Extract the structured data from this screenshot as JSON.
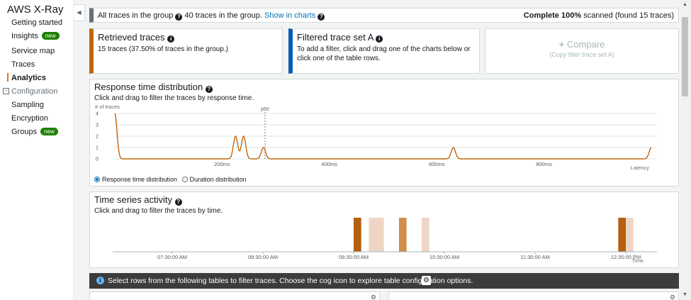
{
  "sidebar": {
    "title": "AWS X-Ray",
    "items": [
      {
        "label": "Getting started"
      },
      {
        "label": "Insights",
        "badge": "new"
      },
      {
        "label": "Service map"
      },
      {
        "label": "Traces"
      },
      {
        "label": "Analytics",
        "active": true
      },
      {
        "label": "Configuration",
        "group": true
      },
      {
        "label": "Sampling"
      },
      {
        "label": "Encryption"
      },
      {
        "label": "Groups",
        "badge": "new"
      }
    ]
  },
  "header": {
    "left_label": "All traces in the group",
    "count_text": "40 traces in the group.",
    "link": "Show in charts",
    "complete_label": "Complete",
    "percent": "100%",
    "scanned_text": "scanned (found 15 traces)"
  },
  "cards": {
    "retrieved": {
      "title": "Retrieved traces",
      "desc": "15 traces (37.50% of traces in the group.)"
    },
    "filtered": {
      "title": "Filtered trace set A",
      "desc": "To add a filter, click and drag one of the charts below or click one of the table rows."
    },
    "compare": {
      "plus": "+",
      "title": "Compare",
      "sub": "(Copy filter trace set A)"
    }
  },
  "response_time": {
    "title": "Response time distribution",
    "subtitle": "Click and drag to filter the traces by response time.",
    "y_label": "# of traces",
    "x_label": "Latency",
    "y_ticks": [
      "4",
      "3",
      "2",
      "1",
      "0"
    ],
    "x_ticks": [
      "200ms",
      "400ms",
      "600ms",
      "800ms"
    ],
    "marker": "p50",
    "radio_1": "Response time distribution",
    "radio_2": "Duration distribution"
  },
  "time_series": {
    "title": "Time series activity",
    "subtitle": "Click and drag to filter the traces by time.",
    "x_label": "Time",
    "x_ticks": [
      "07:30:00 AM",
      "08:30:00 AM",
      "09:30:00 AM",
      "10:30:00 AM",
      "11:30:00 AM",
      "12:30:00 PM"
    ]
  },
  "banner": {
    "message": "Select rows from the following tables to filter traces. Choose the cog icon to explore table configuration options."
  },
  "chart_data": [
    {
      "type": "line",
      "title": "Response time distribution",
      "xlabel": "Latency",
      "ylabel": "# of traces",
      "x_unit": "ms",
      "ylim": [
        0,
        4
      ],
      "y_ticks": [
        0,
        1,
        2,
        3,
        4
      ],
      "x_ticks": [
        200,
        400,
        600,
        800
      ],
      "peaks": [
        {
          "x": 0,
          "y": 4
        },
        {
          "x": 225,
          "y": 2
        },
        {
          "x": 240,
          "y": 2
        },
        {
          "x": 277,
          "y": 1
        },
        {
          "x": 631,
          "y": 1
        },
        {
          "x": 1000,
          "y": 1
        }
      ],
      "marker": {
        "label": "p50",
        "x": 280
      },
      "color": "#c1660f"
    },
    {
      "type": "bar",
      "title": "Time series activity",
      "xlabel": "Time",
      "x_ticks": [
        "07:30:00 AM",
        "08:30:00 AM",
        "09:30:00 AM",
        "10:30:00 AM",
        "11:30:00 AM",
        "12:30:00 PM"
      ],
      "bars": [
        {
          "t": "09:30:00 AM",
          "shade": "dark"
        },
        {
          "t": "09:40:00 AM",
          "shade": "light"
        },
        {
          "t": "09:45:00 AM",
          "shade": "light"
        },
        {
          "t": "10:00:00 AM",
          "shade": "medium"
        },
        {
          "t": "10:15:00 AM",
          "shade": "light"
        },
        {
          "t": "12:25:00 PM",
          "shade": "dark"
        },
        {
          "t": "12:30:00 PM",
          "shade": "light"
        }
      ],
      "colors": {
        "dark": "#b35f0f",
        "medium": "#d08d4c",
        "light": "#efd6c4"
      }
    }
  ]
}
